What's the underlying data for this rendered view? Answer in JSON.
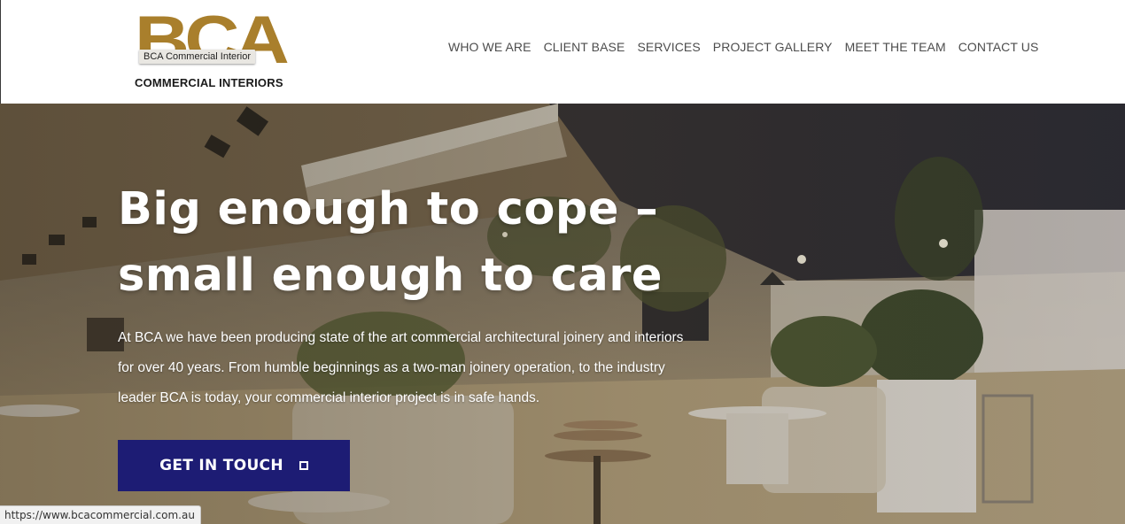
{
  "brand": {
    "logo_letters": "BCA",
    "logo_tag": "BCA Commercial Interior",
    "logo_subtitle": "COMMERCIAL INTERIORS",
    "accent_color": "#a97f2c"
  },
  "nav": {
    "items": [
      {
        "label": "WHO WE ARE"
      },
      {
        "label": "CLIENT BASE"
      },
      {
        "label": "SERVICES"
      },
      {
        "label": "PROJECT GALLERY"
      },
      {
        "label": "MEET THE TEAM"
      },
      {
        "label": "CONTACT US"
      }
    ]
  },
  "hero": {
    "title_line1": "Big enough to cope –",
    "title_line2": "small enough to care",
    "body": "At BCA we have been producing state of the art commercial architectural joinery and interiors for over 40 years. From humble beginnings as a two-man joinery operation, to the industry leader BCA is today, your commercial interior project is in safe hands.",
    "cta_label": "GET IN TOUCH",
    "cta_icon": "square-outline-icon",
    "cta_color": "#1d1c74"
  },
  "status_bar": {
    "url": "https://www.bcacommercial.com.au"
  }
}
